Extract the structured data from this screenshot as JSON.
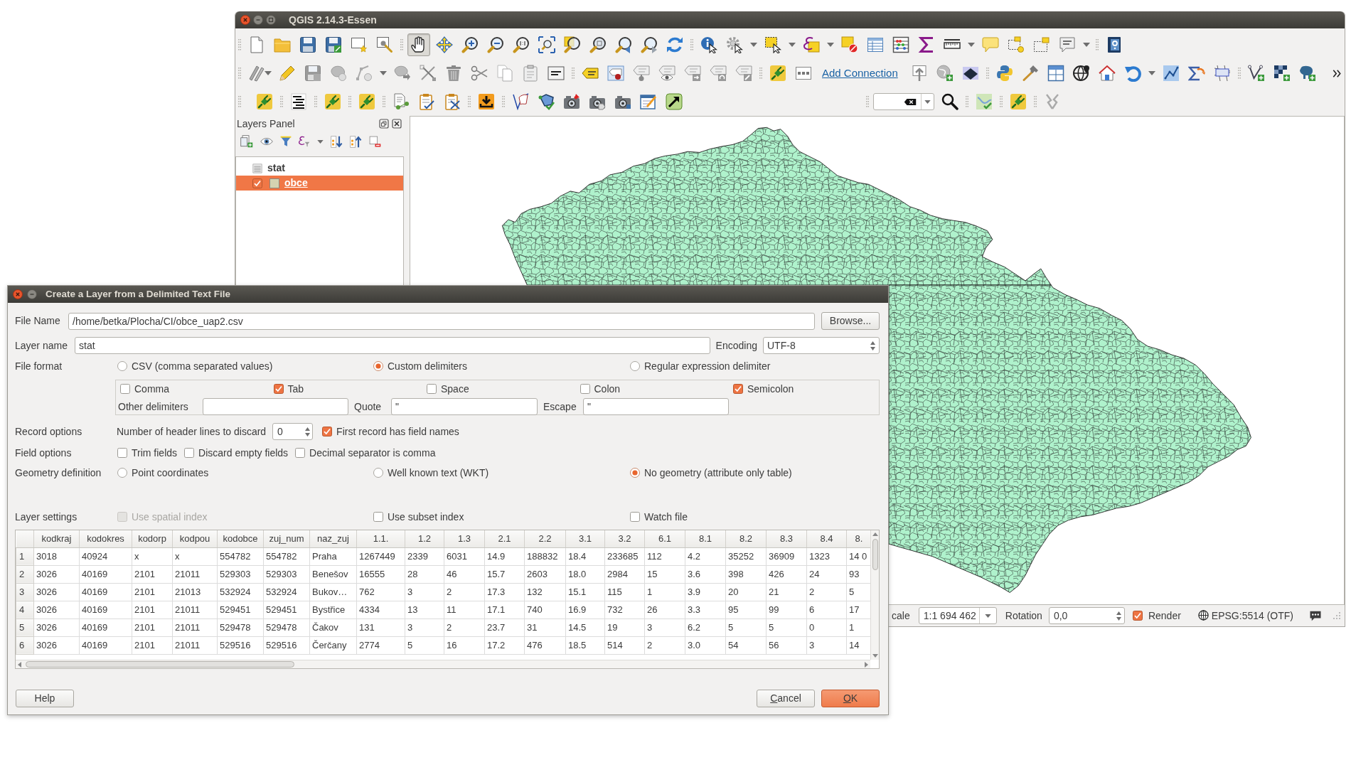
{
  "qgis_window": {
    "title": "QGIS 2.14.3-Essen",
    "pan_tool_selected": true,
    "toolbar_link": "Add Connection"
  },
  "layers_panel": {
    "title": "Layers Panel",
    "layers": [
      {
        "name": "stat",
        "kind": "table",
        "selected": false,
        "editing": false
      },
      {
        "name": "obce",
        "kind": "vector",
        "checked": true,
        "color": "#d5d3b1",
        "selected": true,
        "editing": true
      }
    ]
  },
  "status_bar": {
    "scale_label": "cale",
    "scale": "1:1 694 462",
    "rotation_label": "Rotation",
    "rotation": "0,0",
    "render": {
      "label": "Render",
      "checked": true
    },
    "crs": "EPSG:5514 (OTF)"
  },
  "dialog": {
    "title": "Create a Layer from a Delimited Text File",
    "file_name": {
      "label": "File Name",
      "value": "/home/betka/Plocha/CI/obce_uap2.csv",
      "button": "Browse..."
    },
    "layer_name": {
      "label": "Layer name",
      "value": "stat"
    },
    "encoding": {
      "label": "Encoding",
      "value": "UTF-8"
    },
    "file_format": {
      "label": "File format",
      "options": [
        {
          "label": "CSV (comma separated values)",
          "selected": false
        },
        {
          "label": "Custom delimiters",
          "selected": true
        },
        {
          "label": "Regular expression delimiter",
          "selected": false
        }
      ]
    },
    "delimiters": {
      "options": [
        {
          "label": "Comma",
          "checked": false
        },
        {
          "label": "Tab",
          "checked": true
        },
        {
          "label": "Space",
          "checked": false
        },
        {
          "label": "Colon",
          "checked": false
        },
        {
          "label": "Semicolon",
          "checked": true
        }
      ],
      "other_label": "Other delimiters",
      "quote_label": "Quote",
      "quote": "\"",
      "escape_label": "Escape",
      "escape": "\""
    },
    "record_options": {
      "label": "Record options",
      "header_lines_label": "Number of header lines to discard",
      "header_lines": "0",
      "first_record": {
        "label": "First record has field names",
        "checked": true
      }
    },
    "field_options": {
      "label": "Field options",
      "options": [
        {
          "label": "Trim fields",
          "checked": false
        },
        {
          "label": "Discard empty fields",
          "checked": false
        },
        {
          "label": "Decimal separator is comma",
          "checked": false
        }
      ]
    },
    "geometry": {
      "label": "Geometry definition",
      "options": [
        {
          "label": "Point coordinates",
          "selected": false
        },
        {
          "label": "Well known text (WKT)",
          "selected": false
        },
        {
          "label": "No geometry (attribute only table)",
          "selected": true
        }
      ]
    },
    "layer_settings": {
      "label": "Layer settings",
      "options": [
        {
          "label": "Use spatial index",
          "checked": false,
          "disabled": true
        },
        {
          "label": "Use subset index",
          "checked": false,
          "disabled": false
        },
        {
          "label": "Watch file",
          "checked": false,
          "disabled": false
        }
      ]
    },
    "preview": {
      "columns": [
        "kodkraj",
        "kodokres",
        "kodorp",
        "kodpou",
        "kodobce",
        "zuj_num",
        "naz_zuj",
        "1.1.",
        "1.2",
        "1.3",
        "2.1",
        "2.2",
        "3.1",
        "3.2",
        "6.1",
        "8.1",
        "8.2",
        "8.3",
        "8.4",
        "8."
      ],
      "rows": [
        {
          "number": "1",
          "cells": [
            "3018",
            "40924",
            "x",
            "x",
            "554782",
            "554782",
            "Praha",
            "1267449",
            "2339",
            "6031",
            "14.9",
            "188832",
            "18.4",
            "233685",
            "112",
            "4.2",
            "35252",
            "36909",
            "1323",
            "14 0"
          ]
        },
        {
          "number": "2",
          "cells": [
            "3026",
            "40169",
            "2101",
            "21011",
            "529303",
            "529303",
            "Benešov",
            "16555",
            "28",
            "46",
            "15.7",
            "2603",
            "18.0",
            "2984",
            "15",
            "3.6",
            "398",
            "426",
            "24",
            "93"
          ]
        },
        {
          "number": "3",
          "cells": [
            "3026",
            "40169",
            "2101",
            "21013",
            "532924",
            "532924",
            "Bukov…",
            "762",
            "3",
            "2",
            "17.3",
            "132",
            "15.1",
            "115",
            "1",
            "3.9",
            "20",
            "21",
            "2",
            "5"
          ]
        },
        {
          "number": "4",
          "cells": [
            "3026",
            "40169",
            "2101",
            "21011",
            "529451",
            "529451",
            "Bystřice",
            "4334",
            "13",
            "11",
            "17.1",
            "740",
            "16.9",
            "732",
            "26",
            "3.3",
            "95",
            "99",
            "6",
            "17"
          ]
        },
        {
          "number": "5",
          "cells": [
            "3026",
            "40169",
            "2101",
            "21011",
            "529478",
            "529478",
            "Čakov",
            "131",
            "3",
            "2",
            "23.7",
            "31",
            "14.5",
            "19",
            "3",
            "6.2",
            "5",
            "5",
            "0",
            "1"
          ]
        },
        {
          "number": "6",
          "cells": [
            "3026",
            "40169",
            "2101",
            "21011",
            "529516",
            "529516",
            "Čerčany",
            "2774",
            "5",
            "16",
            "17.2",
            "476",
            "18.5",
            "514",
            "2",
            "3.0",
            "54",
            "56",
            "3",
            "14"
          ]
        }
      ]
    },
    "buttons": [
      {
        "label": "Help",
        "kind": "help"
      },
      {
        "label": "Cancel",
        "kind": "cancel"
      },
      {
        "label": "OK",
        "kind": "default"
      }
    ]
  }
}
